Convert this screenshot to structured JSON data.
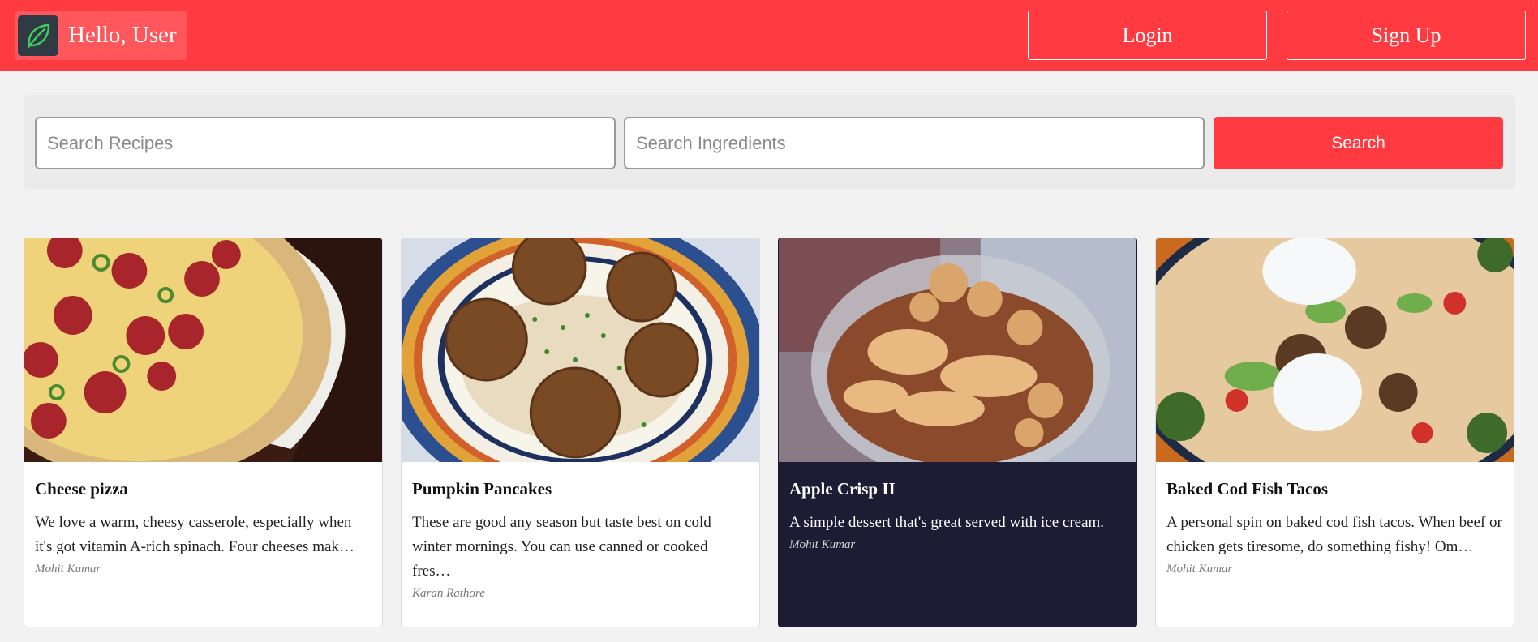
{
  "header": {
    "greeting": "Hello, User",
    "login_label": "Login",
    "signup_label": "Sign Up",
    "logo_icon": "leaf-icon",
    "accent_color": "#ff3a40"
  },
  "search": {
    "recipes_placeholder": "Search Recipes",
    "ingredients_placeholder": "Search Ingredients",
    "button_label": "Search"
  },
  "recipes": [
    {
      "title": "Cheese pizza",
      "description": "We love a warm, cheesy casserole, especially when it's got vitamin A-rich spinach. Four cheeses mak…",
      "author": "Mohit Kumar",
      "image": "pepperoni-pizza-photo"
    },
    {
      "title": "Pumpkin Pancakes",
      "description": "These are good any season but taste best on cold winter mornings. You can use canned or cooked fres…",
      "author": "Karan Rathore",
      "image": "falafel-plate-photo"
    },
    {
      "title": "Apple Crisp II",
      "description": "A simple dessert that's great served with ice cream.",
      "author": "Mohit Kumar",
      "image": "apple-crisp-bowl-photo",
      "highlighted": true
    },
    {
      "title": "Baked Cod Fish Tacos",
      "description": "A personal spin on baked cod fish tacos. When beef or chicken gets tiresome, do something fishy! Om…",
      "author": "Mohit Kumar",
      "image": "fish-taco-photo"
    }
  ]
}
